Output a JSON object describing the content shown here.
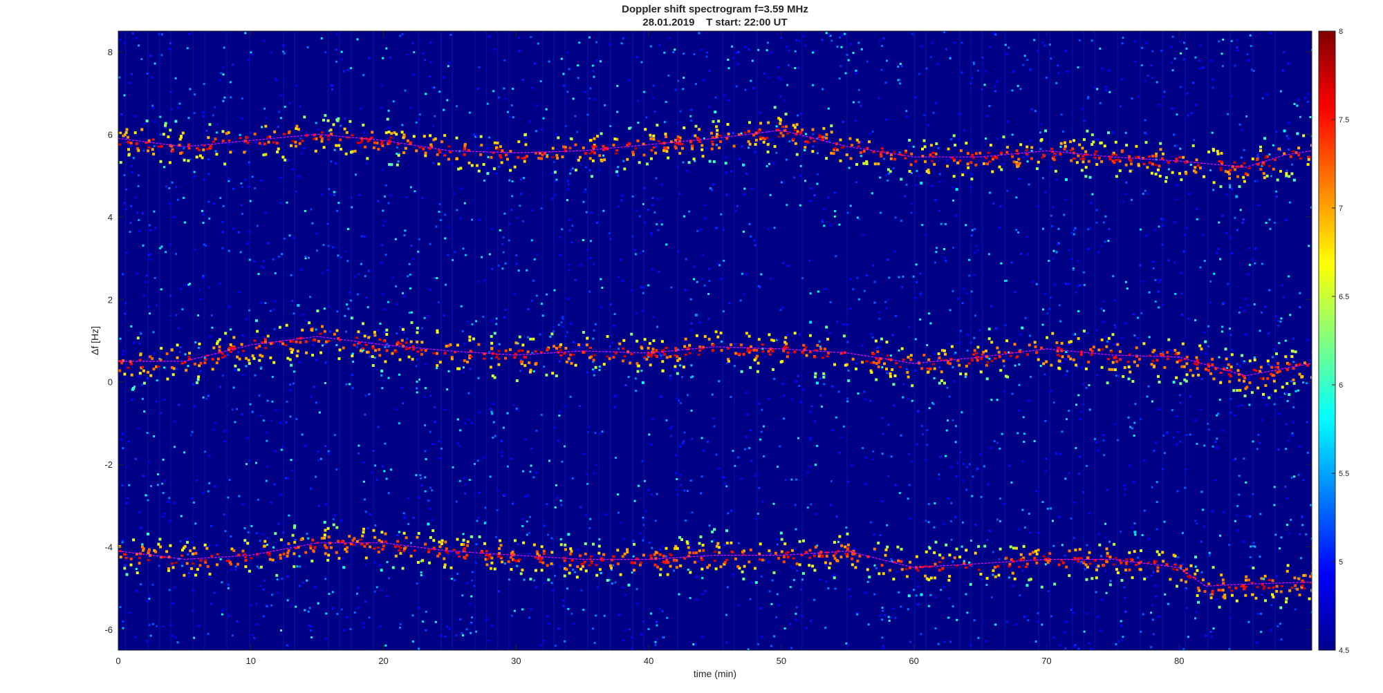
{
  "chart_data": {
    "type": "heatmap",
    "title": "Doppler shift spectrogram f=3.59 MHz",
    "subtitle": "28.01.2019    T start: 22:00 UT",
    "xlabel": "time (min)",
    "ylabel": "Δf [Hz]",
    "xlim": [
      0,
      90
    ],
    "ylim": [
      -6.5,
      8.5
    ],
    "xticks": [
      0,
      10,
      20,
      30,
      40,
      50,
      60,
      70,
      80
    ],
    "yticks": [
      -6,
      -4,
      -2,
      0,
      2,
      4,
      6,
      8
    ],
    "colormap": "jet",
    "clim": [
      4.5,
      8
    ],
    "colorbar_ticks": [
      4.5,
      5,
      5.5,
      6,
      6.5,
      7,
      7.5,
      8
    ],
    "grid": false,
    "bands": [
      {
        "name": "upper",
        "x": [
          0,
          5,
          10,
          15,
          20,
          25,
          30,
          35,
          40,
          45,
          50,
          55,
          60,
          65,
          70,
          75,
          80,
          85,
          88,
          90
        ],
        "y": [
          5.9,
          5.7,
          5.85,
          6.0,
          5.85,
          5.6,
          5.55,
          5.6,
          5.75,
          5.9,
          6.1,
          5.7,
          5.45,
          5.45,
          5.6,
          5.45,
          5.35,
          5.2,
          5.5,
          5.6
        ],
        "width": 0.5
      },
      {
        "name": "middle",
        "x": [
          0,
          5,
          10,
          15,
          20,
          25,
          30,
          35,
          40,
          45,
          50,
          55,
          60,
          65,
          70,
          75,
          80,
          85,
          90
        ],
        "y": [
          0.5,
          0.5,
          0.9,
          1.1,
          0.9,
          0.75,
          0.65,
          0.75,
          0.7,
          0.85,
          0.8,
          0.7,
          0.45,
          0.6,
          0.8,
          0.65,
          0.6,
          0.15,
          0.45
        ],
        "width": 0.55
      },
      {
        "name": "lower",
        "x": [
          0,
          5,
          10,
          15,
          20,
          25,
          30,
          35,
          40,
          45,
          50,
          55,
          60,
          65,
          70,
          75,
          80,
          82,
          85,
          90
        ],
        "y": [
          -4.1,
          -4.3,
          -4.2,
          -3.9,
          -3.9,
          -4.1,
          -4.2,
          -4.3,
          -4.3,
          -4.2,
          -4.2,
          -4.1,
          -4.5,
          -4.4,
          -4.3,
          -4.3,
          -4.5,
          -4.95,
          -4.9,
          -4.85
        ],
        "width": 0.5
      }
    ]
  }
}
